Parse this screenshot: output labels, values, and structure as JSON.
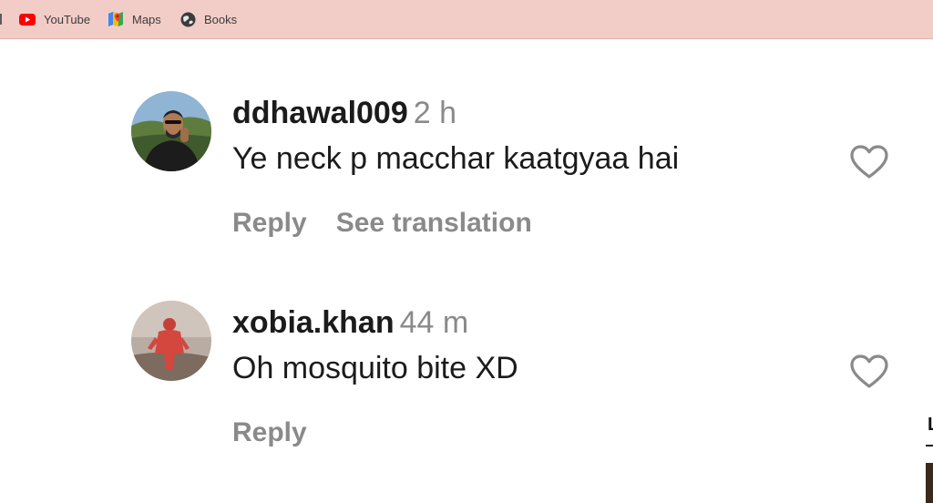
{
  "bookmarks": {
    "items": [
      {
        "label": "YouTube",
        "icon": "youtube-icon"
      },
      {
        "label": "Maps",
        "icon": "maps-icon"
      },
      {
        "label": "Books",
        "icon": "books-icon"
      }
    ]
  },
  "comments": [
    {
      "username": "ddhawal009",
      "time": "2 h",
      "text": "Ye neck p macchar kaatgyaa hai",
      "actions": [
        "Reply",
        "See translation"
      ]
    },
    {
      "username": "xobia.khan",
      "time": "44 m",
      "text": "Oh mosquito bite XD",
      "actions": [
        "Reply"
      ]
    }
  ],
  "edge": {
    "letter": "L"
  },
  "colors": {
    "bookmarks_bar": "#f2cdc7",
    "muted_text": "#8a8a8a",
    "primary_text": "#1b1b1b",
    "youtube_red": "#ff0000"
  }
}
